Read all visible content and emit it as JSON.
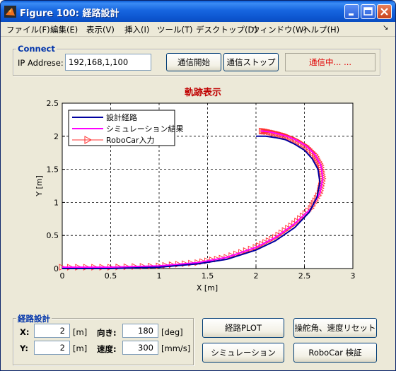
{
  "window": {
    "title": "Figure 100: 経路設計",
    "controls": [
      "minimize",
      "maximize",
      "close"
    ]
  },
  "menu": {
    "items": [
      "ファイル(F)",
      "編集(E)",
      "表示(V)",
      "挿入(I)",
      "ツール(T)",
      "デスクトップ(D)",
      "ウィンドウ(W)",
      "ヘルプ(H)"
    ],
    "dock_arrow": "↘"
  },
  "connect": {
    "title": "Connect",
    "ip_label": "IP Addrese:",
    "ip_value": "192,168,1,100",
    "start_button": "通信開始",
    "stop_button": "通信ストップ",
    "status": "通信中... ..."
  },
  "chart_data": {
    "type": "line",
    "title": "軌跡表示",
    "xlabel": "X [m]",
    "ylabel": "Y [m]",
    "xlim": [
      0,
      3
    ],
    "ylim": [
      0,
      2.5
    ],
    "xticks": [
      0,
      0.5,
      1,
      1.5,
      2,
      2.5,
      3
    ],
    "yticks": [
      0,
      0.5,
      1,
      1.5,
      2,
      2.5
    ],
    "xtick_labels": [
      "0",
      "0.5",
      "1",
      "1.5",
      "2",
      "2.5",
      "3"
    ],
    "ytick_labels": [
      "0",
      "0.5",
      "1",
      "1.5",
      "2",
      "2.5"
    ],
    "grid": "dashed",
    "legend_position": "top-left",
    "series": [
      {
        "name": "設計経路",
        "color": "#0000a0",
        "marker": "none",
        "x": [
          0,
          0.5,
          1.0,
          1.4,
          1.7,
          2.0,
          2.2,
          2.4,
          2.55,
          2.63,
          2.66,
          2.64,
          2.58,
          2.5,
          2.4,
          2.3,
          2.2,
          2.1,
          2.0
        ],
        "y": [
          0,
          0,
          0.02,
          0.07,
          0.14,
          0.28,
          0.42,
          0.62,
          0.85,
          1.08,
          1.3,
          1.5,
          1.66,
          1.79,
          1.88,
          1.95,
          1.98,
          2.0,
          2.0
        ]
      },
      {
        "name": "シミュレーション結果",
        "color": "#ff00ff",
        "marker": "none",
        "x": [
          0,
          0.5,
          1.0,
          1.4,
          1.7,
          2.0,
          2.2,
          2.4,
          2.57,
          2.66,
          2.69,
          2.67,
          2.61,
          2.52,
          2.42,
          2.32,
          2.22,
          2.12,
          2.05
        ],
        "y": [
          0.02,
          0.02,
          0.04,
          0.09,
          0.17,
          0.32,
          0.47,
          0.68,
          0.91,
          1.14,
          1.36,
          1.56,
          1.72,
          1.85,
          1.94,
          2.0,
          2.04,
          2.07,
          2.08
        ]
      },
      {
        "name": "RoboCar入力",
        "color": "#ff3030",
        "marker": "triangle-right",
        "x": [
          0,
          0.5,
          1.0,
          1.4,
          1.7,
          2.0,
          2.2,
          2.4,
          2.57,
          2.66,
          2.69,
          2.67,
          2.61,
          2.52,
          2.42,
          2.32,
          2.22,
          2.12,
          2.05
        ],
        "y": [
          0.02,
          0.02,
          0.04,
          0.09,
          0.17,
          0.32,
          0.47,
          0.68,
          0.91,
          1.14,
          1.36,
          1.56,
          1.72,
          1.85,
          1.94,
          2.0,
          2.04,
          2.07,
          2.08
        ]
      }
    ]
  },
  "design": {
    "title": "経路設計",
    "x_label": "X:",
    "x_value": "2",
    "x_unit": "[m]",
    "y_label": "Y:",
    "y_value": "2",
    "y_unit": "[m]",
    "heading_label": "向き:",
    "heading_value": "180",
    "heading_unit": "[deg]",
    "speed_label": "速度:",
    "speed_value": "300",
    "speed_unit": "[mm/s]"
  },
  "actions": {
    "plot_button": "経路PLOT",
    "reset_button": "操舵角、速度リセット",
    "simulate_button": "シミュレーション",
    "verify_button": "RoboCar 検証"
  }
}
